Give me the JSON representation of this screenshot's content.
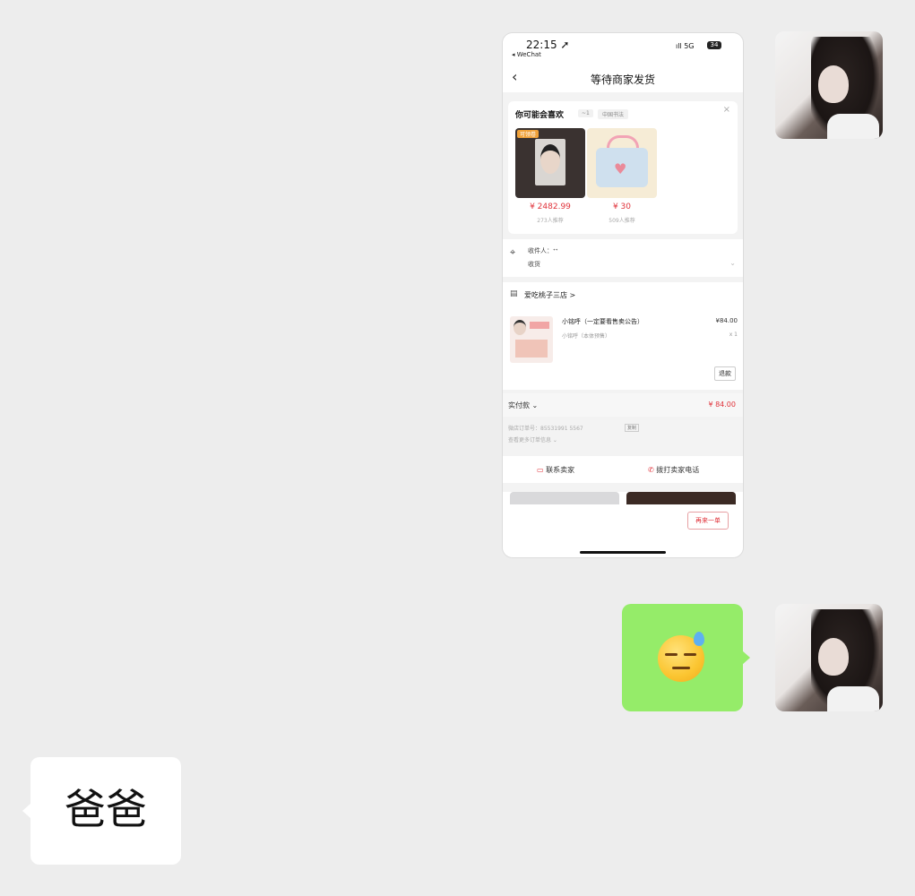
{
  "screenshot": {
    "status_time": "22:15 ➚",
    "status_back_app": "◂ WeChat",
    "status_signal": "ıll 5G",
    "status_battery": "34",
    "nav_back_icon": "chevron-left-icon",
    "nav_title": "等待商家发货",
    "recommend": {
      "title": "你可能会喜欢",
      "tag1": "~1",
      "tag2": "中国书法",
      "close_icon": "close-icon",
      "products": [
        {
          "badge": "可领卷",
          "price": "¥ 2482.99",
          "sold": "273人推荐"
        },
        {
          "price": "¥ 30",
          "sold": "509人推荐"
        }
      ]
    },
    "address": {
      "line1": "收件人：ᐩᐩ",
      "line2": "收货"
    },
    "store_name": "爱吃桃子三店 >",
    "item": {
      "name": "小铭呼（一定要看售卖公告）",
      "sub": "小铭呼（本体预售）",
      "price": "¥84.00",
      "qty": "x 1",
      "refund": "退款"
    },
    "pay": {
      "label": "实付款 ⌄",
      "value": "¥ 84.00"
    },
    "order": {
      "number": "微店订单号：85531991    5567",
      "copy": "复制",
      "more": "查看更多订单信息 ⌄"
    },
    "contact": {
      "seller": "联系卖家",
      "phone": "拨打卖家电话"
    },
    "again_button": "再来一单"
  },
  "messages": [
    {
      "side": "right",
      "type": "image"
    },
    {
      "side": "right",
      "type": "emoji",
      "emoji_name": "sweat-expressionless-face-emoji"
    },
    {
      "side": "left",
      "type": "text",
      "text": "爸爸"
    }
  ],
  "colors": {
    "chat_background": "#ededed",
    "self_bubble": "#95ec69",
    "other_bubble": "#ffffff",
    "price_red": "#e0323a"
  }
}
